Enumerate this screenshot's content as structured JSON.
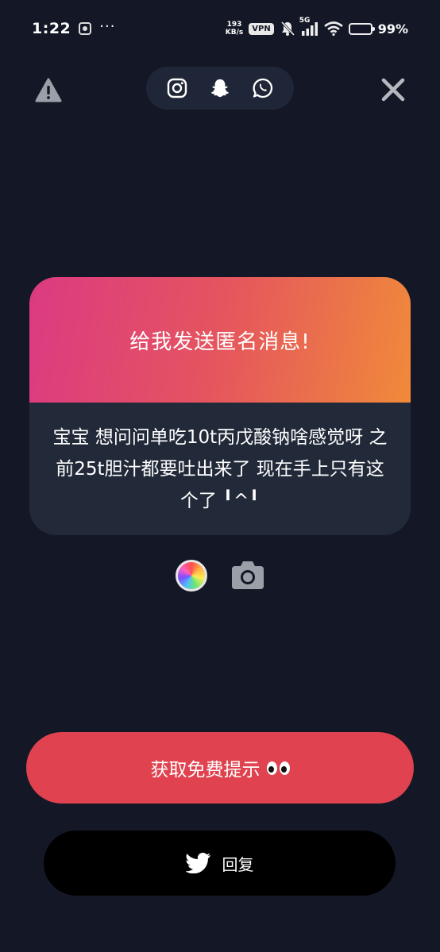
{
  "status_bar": {
    "time": "1:22",
    "dots": "···",
    "net_speed_value": "193",
    "net_speed_unit": "KB/s",
    "vpn": "VPN",
    "signal_label": "5G",
    "battery": "99%"
  },
  "top_bar": {
    "social_icons": [
      "instagram-icon",
      "snapchat-icon",
      "whatsapp-icon"
    ],
    "left_icon": "warning-icon",
    "right_icon": "close-icon"
  },
  "card": {
    "title": "给我发送匿名消息!",
    "message": "宝宝 想问问单吃10t丙戊酸钠啥感觉呀 之前25t胆汁都要吐出来了 现在手上只有这个了 ╹^╹",
    "gradient": [
      "#dc3a82",
      "#e5555e",
      "#f08a3a"
    ],
    "body_color": "#222a3a"
  },
  "tools": {
    "color_icon": "color-wheel-icon",
    "camera_icon": "camera-icon"
  },
  "buttons": {
    "hint_label": "获取免费提示",
    "hint_color": "#e0434f",
    "reply_label": "回复",
    "reply_color": "#000000"
  },
  "colors": {
    "background": "#141826",
    "pill": "#1f2637",
    "icon_gray": "#9aa0a8"
  }
}
